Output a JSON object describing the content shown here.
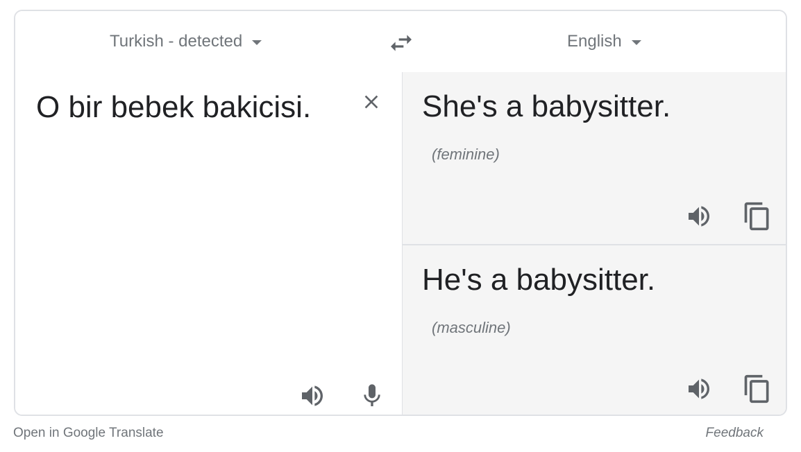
{
  "languages": {
    "source": "Turkish - detected",
    "target": "English"
  },
  "source": {
    "text": "O bir bebek bakicisi."
  },
  "results": [
    {
      "text": "She's a babysitter.",
      "gender": "(feminine)"
    },
    {
      "text": "He's a babysitter.",
      "gender": "(masculine)"
    }
  ],
  "footer": {
    "open_link": "Open in Google Translate",
    "feedback": "Feedback"
  },
  "icons": [
    "chevron-down-icon",
    "swap-icon",
    "close-icon",
    "speaker-icon",
    "microphone-icon",
    "copy-icon"
  ],
  "colors": {
    "text": "#202124",
    "muted": "#70757a",
    "icon": "#5f6368",
    "border": "#dfe1e5",
    "result_bg": "#f5f5f5"
  }
}
